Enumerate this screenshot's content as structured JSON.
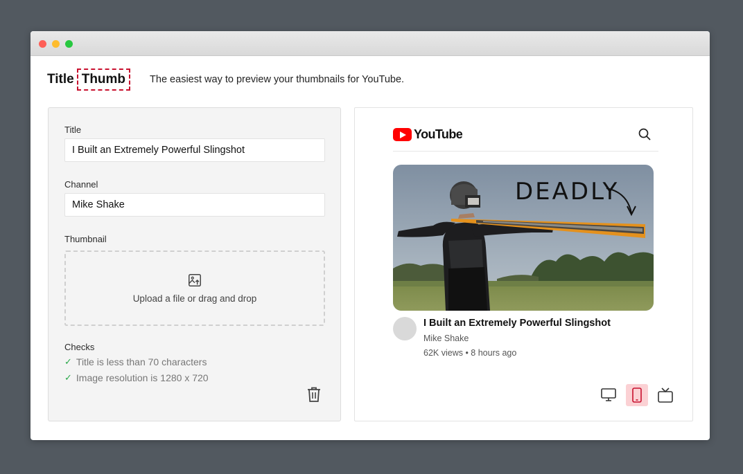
{
  "app": {
    "logo_title": "Title",
    "logo_thumb": "Thumb",
    "tagline": "The easiest way to preview your thumbnails for YouTube."
  },
  "form": {
    "title_label": "Title",
    "title_value": "I Built an Extremely Powerful Slingshot",
    "channel_label": "Channel",
    "channel_value": "Mike Shake",
    "thumbnail_label": "Thumbnail",
    "upload_text": "Upload a file or drag and drop",
    "checks_label": "Checks",
    "checks": [
      "Title is less than 70 characters",
      "Image resolution is 1280 x 720"
    ]
  },
  "preview": {
    "brand": "YouTube",
    "thumbnail_annotation": "DEADLY",
    "video_title": "I Built an Extremely Powerful Slingshot",
    "channel": "Mike Shake",
    "stats": "62K views • 8 hours ago",
    "devices": [
      "desktop-icon",
      "mobile-icon",
      "tv-icon"
    ],
    "active_device": "mobile"
  },
  "colors": {
    "accent": "#c8102e",
    "youtube_red": "#ff0000",
    "check_green": "#2aa84a",
    "active_device_bg": "#fbd1d4"
  }
}
